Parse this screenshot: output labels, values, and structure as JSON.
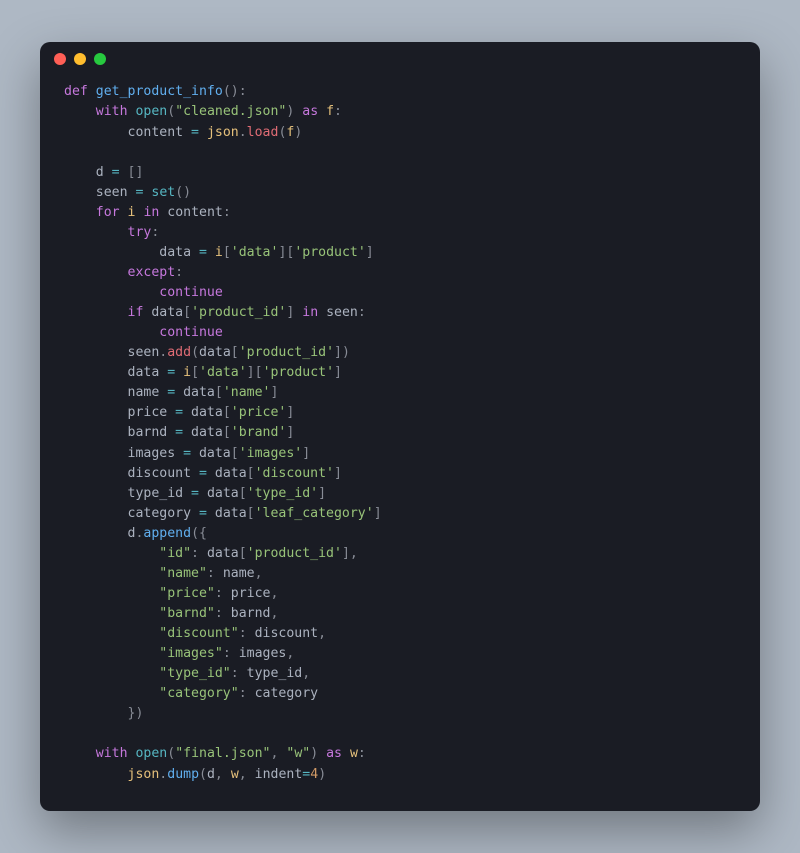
{
  "traffic_lights": [
    "red",
    "yellow",
    "green"
  ],
  "code_lines": [
    [
      [
        "kw",
        "def "
      ],
      [
        "fn",
        "get_product_info"
      ],
      [
        "pn",
        "():"
      ]
    ],
    [
      [
        "pl",
        "    "
      ],
      [
        "kw",
        "with"
      ],
      [
        "pl",
        " "
      ],
      [
        "bi",
        "open"
      ],
      [
        "pn",
        "("
      ],
      [
        "str",
        "\"cleaned.json\""
      ],
      [
        "pn",
        ") "
      ],
      [
        "kw",
        "as"
      ],
      [
        "pl",
        " "
      ],
      [
        "id",
        "f"
      ],
      [
        "pn",
        ":"
      ]
    ],
    [
      [
        "pl",
        "        content "
      ],
      [
        "op",
        "="
      ],
      [
        "pl",
        " "
      ],
      [
        "id",
        "json"
      ],
      [
        "pn",
        "."
      ],
      [
        "attr",
        "load"
      ],
      [
        "pn",
        "("
      ],
      [
        "id",
        "f"
      ],
      [
        "pn",
        ")"
      ]
    ],
    [
      [
        "pl",
        ""
      ]
    ],
    [
      [
        "pl",
        "    d "
      ],
      [
        "op",
        "="
      ],
      [
        "pl",
        " "
      ],
      [
        "pn",
        "[]"
      ]
    ],
    [
      [
        "pl",
        "    seen "
      ],
      [
        "op",
        "="
      ],
      [
        "pl",
        " "
      ],
      [
        "bi",
        "set"
      ],
      [
        "pn",
        "()"
      ]
    ],
    [
      [
        "pl",
        "    "
      ],
      [
        "kw",
        "for"
      ],
      [
        "pl",
        " "
      ],
      [
        "id",
        "i"
      ],
      [
        "pl",
        " "
      ],
      [
        "kw",
        "in"
      ],
      [
        "pl",
        " content"
      ],
      [
        "pn",
        ":"
      ]
    ],
    [
      [
        "pl",
        "        "
      ],
      [
        "kw",
        "try"
      ],
      [
        "pn",
        ":"
      ]
    ],
    [
      [
        "pl",
        "            data "
      ],
      [
        "op",
        "="
      ],
      [
        "pl",
        " "
      ],
      [
        "id",
        "i"
      ],
      [
        "pn",
        "["
      ],
      [
        "str",
        "'data'"
      ],
      [
        "pn",
        "]["
      ],
      [
        "str",
        "'product'"
      ],
      [
        "pn",
        "]"
      ]
    ],
    [
      [
        "pl",
        "        "
      ],
      [
        "kw",
        "except"
      ],
      [
        "pn",
        ":"
      ]
    ],
    [
      [
        "pl",
        "            "
      ],
      [
        "kw",
        "continue"
      ]
    ],
    [
      [
        "pl",
        "        "
      ],
      [
        "kw",
        "if"
      ],
      [
        "pl",
        " data"
      ],
      [
        "pn",
        "["
      ],
      [
        "str",
        "'product_id'"
      ],
      [
        "pn",
        "] "
      ],
      [
        "kw",
        "in"
      ],
      [
        "pl",
        " seen"
      ],
      [
        "pn",
        ":"
      ]
    ],
    [
      [
        "pl",
        "            "
      ],
      [
        "kw",
        "continue"
      ]
    ],
    [
      [
        "pl",
        "        seen"
      ],
      [
        "pn",
        "."
      ],
      [
        "attr",
        "add"
      ],
      [
        "pn",
        "("
      ],
      [
        "pl",
        "data"
      ],
      [
        "pn",
        "["
      ],
      [
        "str",
        "'product_id'"
      ],
      [
        "pn",
        "])"
      ]
    ],
    [
      [
        "pl",
        "        data "
      ],
      [
        "op",
        "="
      ],
      [
        "pl",
        " "
      ],
      [
        "id",
        "i"
      ],
      [
        "pn",
        "["
      ],
      [
        "str",
        "'data'"
      ],
      [
        "pn",
        "]["
      ],
      [
        "str",
        "'product'"
      ],
      [
        "pn",
        "]"
      ]
    ],
    [
      [
        "pl",
        "        name "
      ],
      [
        "op",
        "="
      ],
      [
        "pl",
        " data"
      ],
      [
        "pn",
        "["
      ],
      [
        "str",
        "'name'"
      ],
      [
        "pn",
        "]"
      ]
    ],
    [
      [
        "pl",
        "        price "
      ],
      [
        "op",
        "="
      ],
      [
        "pl",
        " data"
      ],
      [
        "pn",
        "["
      ],
      [
        "str",
        "'price'"
      ],
      [
        "pn",
        "]"
      ]
    ],
    [
      [
        "pl",
        "        barnd "
      ],
      [
        "op",
        "="
      ],
      [
        "pl",
        " data"
      ],
      [
        "pn",
        "["
      ],
      [
        "str",
        "'brand'"
      ],
      [
        "pn",
        "]"
      ]
    ],
    [
      [
        "pl",
        "        images "
      ],
      [
        "op",
        "="
      ],
      [
        "pl",
        " data"
      ],
      [
        "pn",
        "["
      ],
      [
        "str",
        "'images'"
      ],
      [
        "pn",
        "]"
      ]
    ],
    [
      [
        "pl",
        "        discount "
      ],
      [
        "op",
        "="
      ],
      [
        "pl",
        " data"
      ],
      [
        "pn",
        "["
      ],
      [
        "str",
        "'discount'"
      ],
      [
        "pn",
        "]"
      ]
    ],
    [
      [
        "pl",
        "        type_id "
      ],
      [
        "op",
        "="
      ],
      [
        "pl",
        " data"
      ],
      [
        "pn",
        "["
      ],
      [
        "str",
        "'type_id'"
      ],
      [
        "pn",
        "]"
      ]
    ],
    [
      [
        "pl",
        "        category "
      ],
      [
        "op",
        "="
      ],
      [
        "pl",
        " data"
      ],
      [
        "pn",
        "["
      ],
      [
        "str",
        "'leaf_category'"
      ],
      [
        "pn",
        "]"
      ]
    ],
    [
      [
        "pl",
        "        d"
      ],
      [
        "pn",
        "."
      ],
      [
        "mem",
        "append"
      ],
      [
        "pn",
        "({"
      ]
    ],
    [
      [
        "pl",
        "            "
      ],
      [
        "str",
        "\"id\""
      ],
      [
        "pn",
        ": "
      ],
      [
        "pl",
        "data"
      ],
      [
        "pn",
        "["
      ],
      [
        "str",
        "'product_id'"
      ],
      [
        "pn",
        "],"
      ]
    ],
    [
      [
        "pl",
        "            "
      ],
      [
        "str",
        "\"name\""
      ],
      [
        "pn",
        ": "
      ],
      [
        "pl",
        "name"
      ],
      [
        "pn",
        ","
      ]
    ],
    [
      [
        "pl",
        "            "
      ],
      [
        "str",
        "\"price\""
      ],
      [
        "pn",
        ": "
      ],
      [
        "pl",
        "price"
      ],
      [
        "pn",
        ","
      ]
    ],
    [
      [
        "pl",
        "            "
      ],
      [
        "str",
        "\"barnd\""
      ],
      [
        "pn",
        ": "
      ],
      [
        "pl",
        "barnd"
      ],
      [
        "pn",
        ","
      ]
    ],
    [
      [
        "pl",
        "            "
      ],
      [
        "str",
        "\"discount\""
      ],
      [
        "pn",
        ": "
      ],
      [
        "pl",
        "discount"
      ],
      [
        "pn",
        ","
      ]
    ],
    [
      [
        "pl",
        "            "
      ],
      [
        "str",
        "\"images\""
      ],
      [
        "pn",
        ": "
      ],
      [
        "pl",
        "images"
      ],
      [
        "pn",
        ","
      ]
    ],
    [
      [
        "pl",
        "            "
      ],
      [
        "str",
        "\"type_id\""
      ],
      [
        "pn",
        ": "
      ],
      [
        "pl",
        "type_id"
      ],
      [
        "pn",
        ","
      ]
    ],
    [
      [
        "pl",
        "            "
      ],
      [
        "str",
        "\"category\""
      ],
      [
        "pn",
        ": "
      ],
      [
        "pl",
        "category"
      ]
    ],
    [
      [
        "pl",
        "        "
      ],
      [
        "pn",
        "})"
      ]
    ],
    [
      [
        "pl",
        ""
      ]
    ],
    [
      [
        "pl",
        "    "
      ],
      [
        "kw",
        "with"
      ],
      [
        "pl",
        " "
      ],
      [
        "bi",
        "open"
      ],
      [
        "pn",
        "("
      ],
      [
        "str",
        "\"final.json\""
      ],
      [
        "pn",
        ", "
      ],
      [
        "str",
        "\"w\""
      ],
      [
        "pn",
        ") "
      ],
      [
        "kw",
        "as"
      ],
      [
        "pl",
        " "
      ],
      [
        "id",
        "w"
      ],
      [
        "pn",
        ":"
      ]
    ],
    [
      [
        "pl",
        "        "
      ],
      [
        "id",
        "json"
      ],
      [
        "pn",
        "."
      ],
      [
        "mem",
        "dump"
      ],
      [
        "pn",
        "("
      ],
      [
        "pl",
        "d"
      ],
      [
        "pn",
        ", "
      ],
      [
        "id",
        "w"
      ],
      [
        "pn",
        ", "
      ],
      [
        "pl",
        "indent"
      ],
      [
        "op",
        "="
      ],
      [
        "num",
        "4"
      ],
      [
        "pn",
        ")"
      ]
    ]
  ]
}
